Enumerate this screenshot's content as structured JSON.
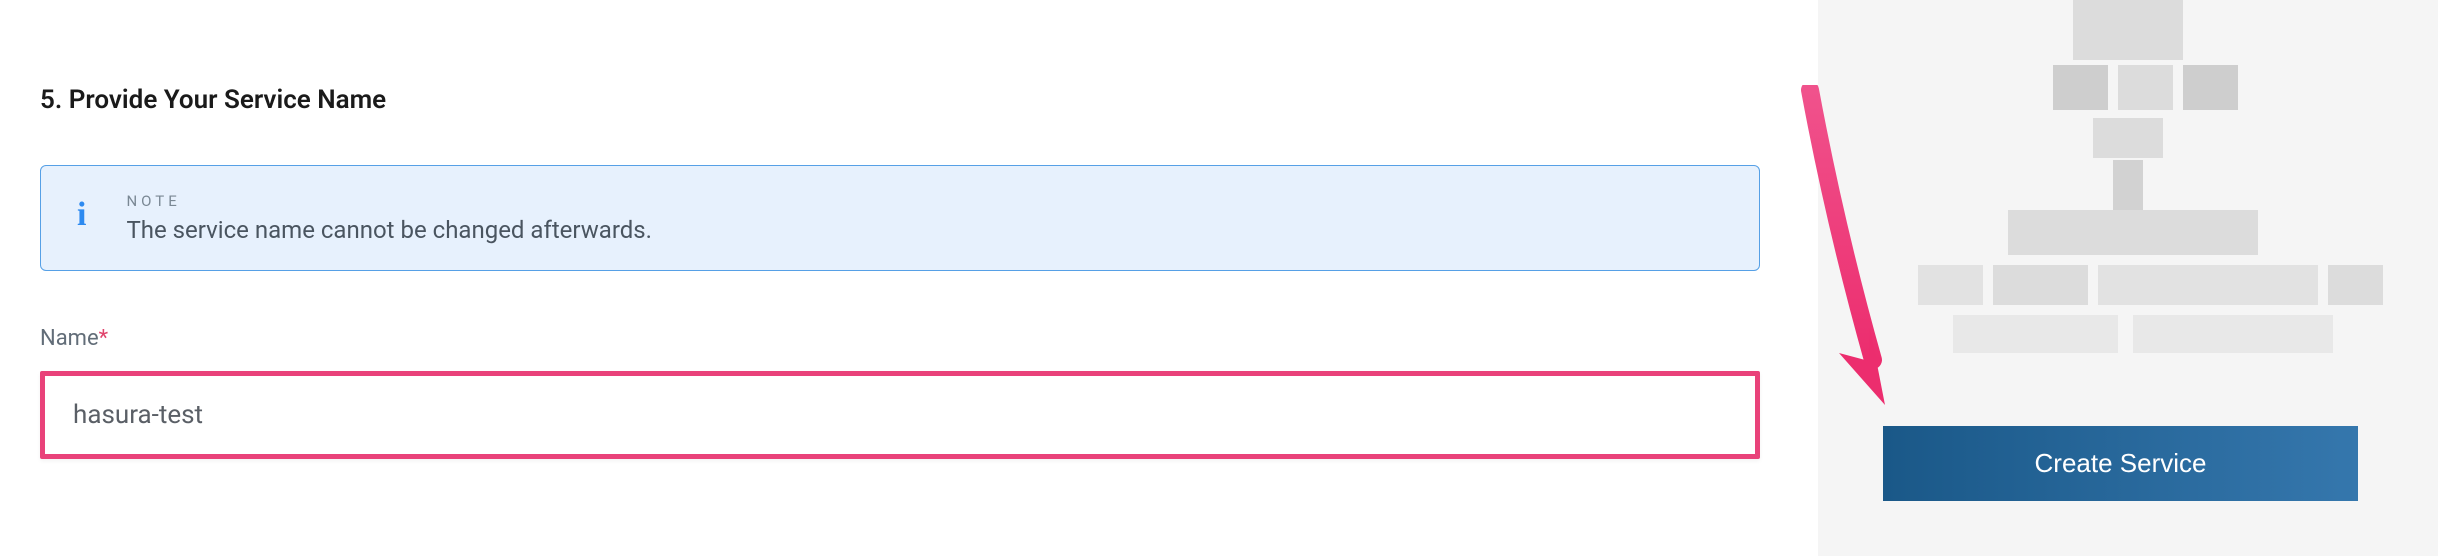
{
  "step": {
    "heading": "5. Provide Your Service Name"
  },
  "note": {
    "label": "NOTE",
    "text": "The service name cannot be changed afterwards."
  },
  "field": {
    "label": "Name",
    "required_marker": "*",
    "value": "hasura-test"
  },
  "actions": {
    "create": "Create Service"
  }
}
